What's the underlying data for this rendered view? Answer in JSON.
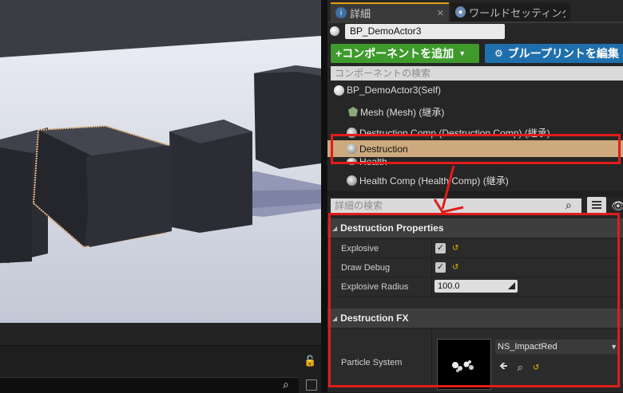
{
  "tabs": [
    {
      "label": "詳細",
      "icon": "info-icon"
    },
    {
      "label": "ワールドセッティング",
      "icon": "globe-icon"
    }
  ],
  "actor": {
    "name": "BP_DemoActor3"
  },
  "buttons": {
    "add_component": "+コンポーネントを追加",
    "blueprint": "ブループリントを編集"
  },
  "component_search": {
    "placeholder": "コンポーネントの検索"
  },
  "components": [
    {
      "label": "BP_DemoActor3(Self)",
      "icon": "actor-sphere-icon"
    },
    {
      "label": "Mesh (Mesh) (継承)",
      "icon": "mesh-icon"
    },
    {
      "label": "Destruction Comp (Destruction Comp) (継承)",
      "icon": "component-icon"
    },
    {
      "label": "Destruction",
      "icon": "component-icon",
      "selected": true
    },
    {
      "label": "Health",
      "icon": "component-icon"
    },
    {
      "label": "Health Comp (Health Comp) (継承)",
      "icon": "component-icon"
    }
  ],
  "details_search": {
    "placeholder": "詳細の検索"
  },
  "categories": {
    "destruction_properties": "Destruction Properties",
    "destruction_fx": "Destruction FX"
  },
  "properties": {
    "explosive": {
      "label": "Explosive",
      "checked": true
    },
    "draw_debug": {
      "label": "Draw Debug",
      "checked": true
    },
    "explosive_radius": {
      "label": "Explosive Radius",
      "value": "100.0"
    },
    "particle_system": {
      "label": "Particle System",
      "value": "NS_ImpactRed"
    }
  },
  "colors": {
    "selection_highlight": "#cdaa7d",
    "annotation_red": "#e01c1c",
    "add_button": "#3f9a2c",
    "blueprint_button": "#1f6fad",
    "tab_accent": "#e3a012"
  }
}
